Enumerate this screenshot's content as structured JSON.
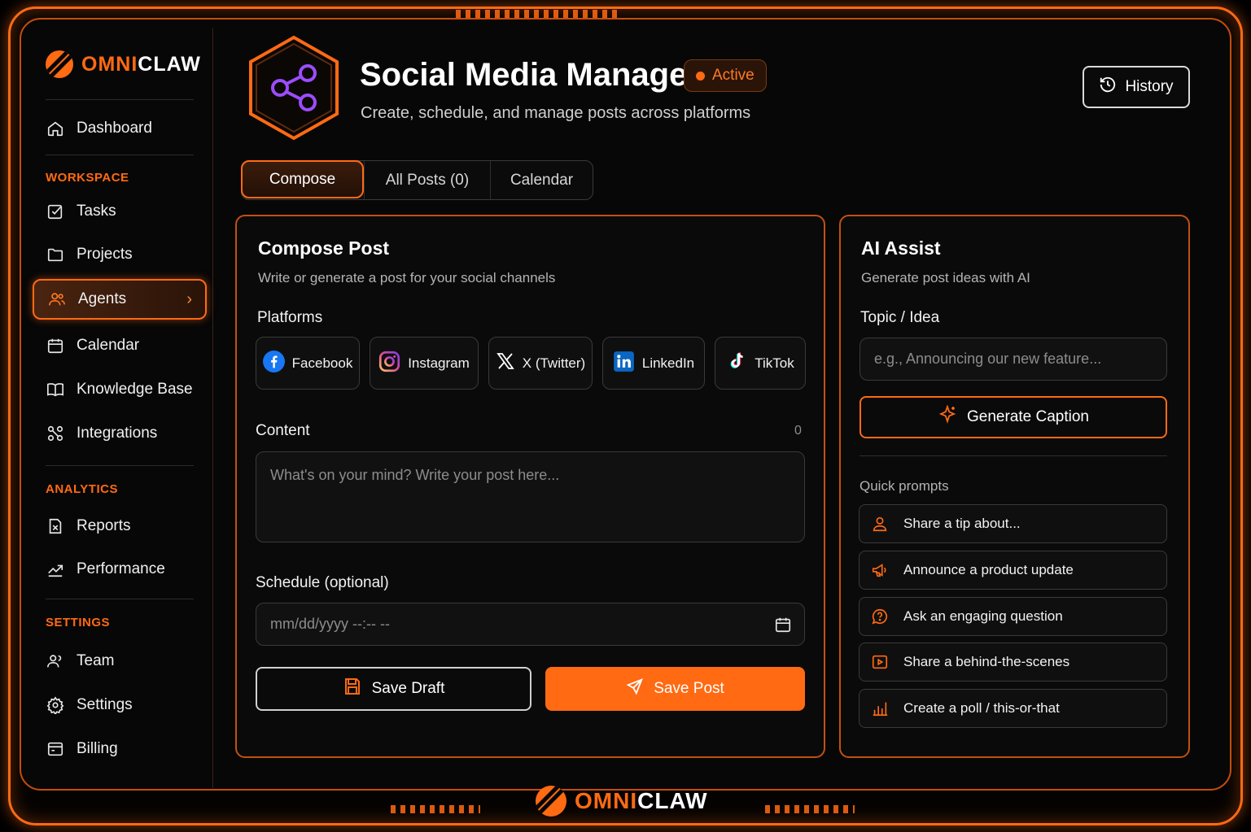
{
  "brand": {
    "omni": "OMNI",
    "claw": "CLAW"
  },
  "sidebar": {
    "dashboard": "Dashboard",
    "sections": {
      "workspace": "WORKSPACE",
      "analytics": "ANALYTICS",
      "settings": "SETTINGS"
    },
    "items": {
      "tasks": "Tasks",
      "projects": "Projects",
      "agents": "Agents",
      "calendar": "Calendar",
      "knowledge_base": "Knowledge Base",
      "integrations": "Integrations",
      "reports": "Reports",
      "performance": "Performance",
      "team": "Team",
      "settings": "Settings",
      "billing": "Billing"
    }
  },
  "header": {
    "title": "Social Media Manager",
    "status": "Active",
    "subtitle": "Create, schedule, and manage posts across platforms",
    "history_label": "History"
  },
  "tabs": {
    "compose": "Compose",
    "all_posts": "All Posts (0)",
    "calendar": "Calendar"
  },
  "compose": {
    "title": "Compose Post",
    "subtitle": "Write or generate a post for your social channels",
    "platforms_label": "Platforms",
    "platforms": {
      "facebook": "Facebook",
      "instagram": "Instagram",
      "x": "X (Twitter)",
      "linkedin": "LinkedIn",
      "tiktok": "TikTok"
    },
    "content_label": "Content",
    "char_count": "0",
    "content_placeholder": "What's on your mind? Write your post here...",
    "schedule_label": "Schedule (optional)",
    "schedule_placeholder": "mm/dd/yyyy --:-- --",
    "save_draft": "Save Draft",
    "save_post": "Save Post"
  },
  "ai_assist": {
    "title": "AI Assist",
    "subtitle": "Generate post ideas with AI",
    "topic_label": "Topic / Idea",
    "topic_placeholder": "e.g., Announcing our new feature...",
    "generate_label": "Generate Caption",
    "quick_prompts_label": "Quick prompts",
    "prompts": {
      "tip": "Share a tip about...",
      "announce": "Announce a product update",
      "question": "Ask an engaging question",
      "bts": "Share a behind-the-scenes",
      "poll": "Create a poll / this-or-that"
    }
  },
  "colors": {
    "accent": "#ff6a13",
    "background": "#000000",
    "panel": "#0a0a0a"
  }
}
